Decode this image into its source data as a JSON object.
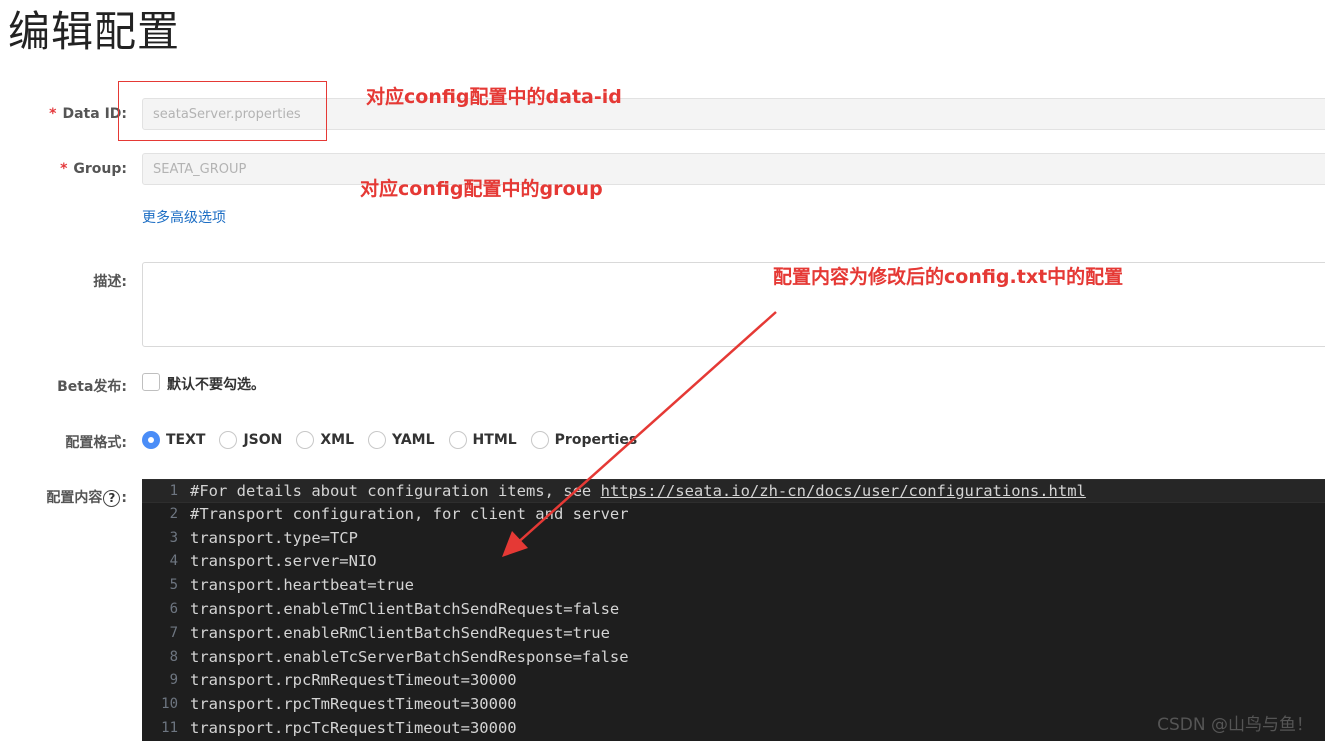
{
  "page": {
    "title": "编辑配置"
  },
  "form": {
    "data_id": {
      "label": "Data ID:",
      "required_mark": "*",
      "value": "seataServer.properties"
    },
    "group": {
      "label": "Group:",
      "required_mark": "*",
      "value": "SEATA_GROUP"
    },
    "advanced_link": "更多高级选项",
    "description": {
      "label": "描述:",
      "value": ""
    },
    "beta": {
      "label": "Beta发布:",
      "checkbox_label": "默认不要勾选。",
      "checked": false
    },
    "format": {
      "label": "配置格式:",
      "options": [
        "TEXT",
        "JSON",
        "XML",
        "YAML",
        "HTML",
        "Properties"
      ],
      "selected": "TEXT"
    },
    "content": {
      "label_prefix": "配置内容",
      "help_glyph": "?",
      "label_suffix": ":",
      "help_icon": "question-circle-icon"
    }
  },
  "editor": {
    "lines": [
      {
        "n": "1",
        "text": "#For details about configuration items, see ",
        "link": "https://seata.io/zh-cn/docs/user/configurations.html"
      },
      {
        "n": "2",
        "text": "#Transport configuration, for client and server"
      },
      {
        "n": "3",
        "text": "transport.type=TCP"
      },
      {
        "n": "4",
        "text": "transport.server=NIO"
      },
      {
        "n": "5",
        "text": "transport.heartbeat=true"
      },
      {
        "n": "6",
        "text": "transport.enableTmClientBatchSendRequest=false"
      },
      {
        "n": "7",
        "text": "transport.enableRmClientBatchSendRequest=true"
      },
      {
        "n": "8",
        "text": "transport.enableTcServerBatchSendResponse=false"
      },
      {
        "n": "9",
        "text": "transport.rpcRmRequestTimeout=30000"
      },
      {
        "n": "10",
        "text": "transport.rpcTmRequestTimeout=30000"
      },
      {
        "n": "11",
        "text": "transport.rpcTcRequestTimeout=30000"
      }
    ]
  },
  "annotations": {
    "data_id_note": "对应config配置中的data-id",
    "group_note": "对应config配置中的group",
    "content_note": "配置内容为修改后的config.txt中的配置",
    "color": "#e53935"
  },
  "watermark": "CSDN @山鸟与鱼！",
  "colors": {
    "accent": "#4a8df7",
    "link": "#1d6ec4",
    "editor_bg": "#1e1e1e",
    "annotation": "#e53935"
  }
}
